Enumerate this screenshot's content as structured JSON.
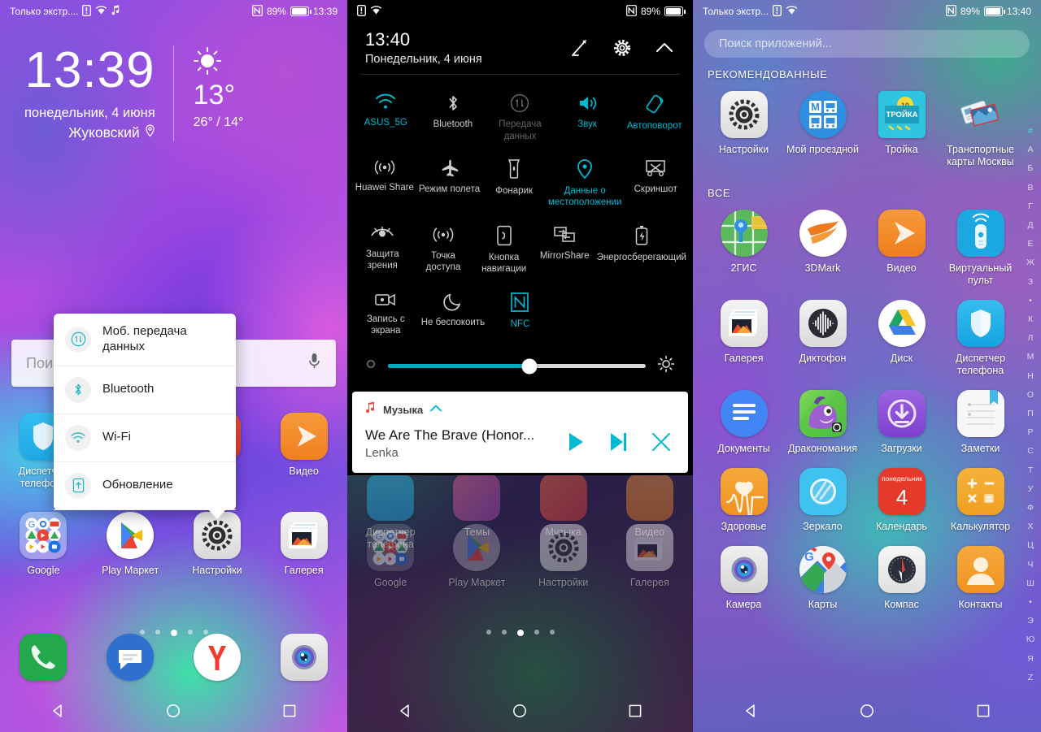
{
  "colors": {
    "accent": "#00b9d4",
    "accent_dark": "#00a9c4",
    "white": "#ffffff"
  },
  "panel1": {
    "statusbar": {
      "carrier": "Только экстр....",
      "battery_percent": "89%",
      "time": "13:39"
    },
    "clock_widget": {
      "time": "13:39",
      "date": "понедельник, 4 июня",
      "city": "Жуковский",
      "temp_now": "13°",
      "temp_range": "26° / 14°"
    },
    "search_widget": {
      "placeholder": "Пои"
    },
    "popup": {
      "items": [
        {
          "label": "Моб. передача данных",
          "icon": "mobile-data-icon"
        },
        {
          "label": "Bluetooth",
          "icon": "bluetooth-icon"
        },
        {
          "label": "Wi-Fi",
          "icon": "wifi-icon"
        },
        {
          "label": "Обновление",
          "icon": "update-icon"
        }
      ]
    },
    "apps_row1": [
      {
        "label": "Диспетчер телефона",
        "icon": "phone-manager-icon"
      },
      {
        "label": "",
        "icon": "themes-icon"
      },
      {
        "label": "",
        "icon": "music-icon"
      },
      {
        "label": "Видео",
        "icon": "video-icon"
      }
    ],
    "apps_row2": [
      {
        "label": "Google",
        "icon": "google-folder-icon"
      },
      {
        "label": "Play Маркет",
        "icon": "play-store-icon"
      },
      {
        "label": "Настройки",
        "icon": "settings-icon"
      },
      {
        "label": "Галерея",
        "icon": "gallery-icon"
      }
    ],
    "page_dots": {
      "count": 5,
      "active_index": 2
    },
    "dock": [
      {
        "label": "",
        "icon": "phone-icon"
      },
      {
        "label": "",
        "icon": "messages-icon"
      },
      {
        "label": "",
        "icon": "yandex-icon"
      },
      {
        "label": "",
        "icon": "camera-icon"
      }
    ],
    "navbar": [
      {
        "name": "back-button",
        "icon": "triangle-back-icon"
      },
      {
        "name": "home-button",
        "icon": "circle-home-icon"
      },
      {
        "name": "recents-button",
        "icon": "square-recents-icon"
      }
    ]
  },
  "panel2": {
    "statusbar": {
      "battery_percent": "89%"
    },
    "header": {
      "time": "13:40",
      "date": "Понедельник, 4 июня",
      "edit": "edit-icon",
      "settings": "gear-icon",
      "collapse": "chevron-up-icon"
    },
    "tiles": [
      {
        "label": "ASUS_5G",
        "icon": "wifi-icon",
        "state": "on"
      },
      {
        "label": "Bluetooth",
        "icon": "bluetooth-icon",
        "state": "default"
      },
      {
        "label": "Передача данных",
        "icon": "mobile-data-icon",
        "state": "disabled"
      },
      {
        "label": "Звук",
        "icon": "sound-icon",
        "state": "on"
      },
      {
        "label": "Автоповорот",
        "icon": "autorotate-icon",
        "state": "on"
      },
      {
        "label": "Huawei Share",
        "icon": "huawei-share-icon",
        "state": "default"
      },
      {
        "label": "Режим полета",
        "icon": "airplane-icon",
        "state": "default"
      },
      {
        "label": "Фонарик",
        "icon": "flashlight-icon",
        "state": "default"
      },
      {
        "label": "Данные о местоположении",
        "icon": "location-icon",
        "state": "on"
      },
      {
        "label": "Скриншот",
        "icon": "screenshot-icon",
        "state": "default"
      },
      {
        "label": "Защита зрения",
        "icon": "eye-comfort-icon",
        "state": "default"
      },
      {
        "label": "Точка доступа",
        "icon": "hotspot-icon",
        "state": "default"
      },
      {
        "label": "Кнопка навигации",
        "icon": "nav-button-icon",
        "state": "default"
      },
      {
        "label": "MirrorShare",
        "icon": "mirrorshare-icon",
        "state": "default"
      },
      {
        "label": "Энергосберегающий",
        "icon": "power-save-icon",
        "state": "default"
      },
      {
        "label": "Запись с экрана",
        "icon": "screen-record-icon",
        "state": "default"
      },
      {
        "label": "Не беспокоить",
        "icon": "do-not-disturb-icon",
        "state": "default"
      },
      {
        "label": "NFC",
        "icon": "nfc-icon",
        "state": "on"
      }
    ],
    "brightness": {
      "value_percent": 55,
      "low_icon": "brightness-low-icon",
      "high_icon": "brightness-high-icon"
    },
    "notification": {
      "app": "Музыка",
      "title": "We Are The Brave (Honor...",
      "artist": "Lenka",
      "controls": [
        {
          "name": "play-button",
          "icon": "play-icon"
        },
        {
          "name": "next-button",
          "icon": "next-track-icon"
        },
        {
          "name": "dismiss-button",
          "icon": "close-icon"
        }
      ]
    },
    "dim_home": {
      "row1": [
        {
          "label": "Диспетчер телефона",
          "icon": "phone-manager-icon"
        },
        {
          "label": "Темы",
          "icon": "themes-icon"
        },
        {
          "label": "Музыка",
          "icon": "music-icon"
        },
        {
          "label": "Видео",
          "icon": "video-icon"
        }
      ],
      "row2": [
        {
          "label": "Google",
          "icon": "google-folder-icon"
        },
        {
          "label": "Play Маркет",
          "icon": "play-store-icon"
        },
        {
          "label": "Настройки",
          "icon": "settings-icon"
        },
        {
          "label": "Галерея",
          "icon": "gallery-icon"
        }
      ],
      "page_dots": {
        "count": 5,
        "active_index": 2
      }
    }
  },
  "panel3": {
    "statusbar": {
      "carrier": "Только экстр...",
      "battery_percent": "89%",
      "time": "13:40"
    },
    "search": {
      "placeholder": "Поиск приложений..."
    },
    "sections": [
      {
        "title": "РЕКОМЕНДОВАННЫЕ",
        "apps": [
          {
            "label": "Настройки",
            "icon": "settings-icon"
          },
          {
            "label": "Мой проездной",
            "icon": "moy-proezdnoy-icon"
          },
          {
            "label": "Тройка",
            "icon": "troika-icon"
          },
          {
            "label": "Транспортные карты Москвы",
            "icon": "transport-cards-icon"
          }
        ]
      },
      {
        "title": "ВСЕ",
        "apps": [
          {
            "label": "2ГИС",
            "icon": "2gis-icon"
          },
          {
            "label": "3DMark",
            "icon": "3dmark-icon"
          },
          {
            "label": "Видео",
            "icon": "video-icon"
          },
          {
            "label": "Виртуальный пульт",
            "icon": "virtual-remote-icon"
          },
          {
            "label": "Галерея",
            "icon": "gallery-icon"
          },
          {
            "label": "Диктофон",
            "icon": "recorder-icon"
          },
          {
            "label": "Диск",
            "icon": "google-drive-icon"
          },
          {
            "label": "Диспетчер телефона",
            "icon": "phone-manager-icon"
          },
          {
            "label": "Документы",
            "icon": "google-docs-icon"
          },
          {
            "label": "Дракономания",
            "icon": "dragon-mania-icon"
          },
          {
            "label": "Загрузки",
            "icon": "downloads-icon"
          },
          {
            "label": "Заметки",
            "icon": "notes-icon"
          },
          {
            "label": "Здоровье",
            "icon": "health-icon"
          },
          {
            "label": "Зеркало",
            "icon": "mirror-icon"
          },
          {
            "label": "Календарь",
            "icon": "calendar-icon",
            "badge_top": "понедельник",
            "badge_day": "4"
          },
          {
            "label": "Калькулятор",
            "icon": "calculator-icon"
          },
          {
            "label": "Камера",
            "icon": "camera-icon"
          },
          {
            "label": "Карты",
            "icon": "google-maps-icon"
          },
          {
            "label": "Компас",
            "icon": "compass-icon"
          },
          {
            "label": "Контакты",
            "icon": "contacts-icon"
          }
        ]
      }
    ],
    "alphabet_index": [
      "#",
      "А",
      "Б",
      "В",
      "Г",
      "Д",
      "Е",
      "Ж",
      "З",
      "•",
      "К",
      "Л",
      "М",
      "Н",
      "О",
      "П",
      "Р",
      "С",
      "Т",
      "У",
      "Ф",
      "Х",
      "Ц",
      "Ч",
      "Ш",
      "•",
      "Э",
      "Ю",
      "Я",
      "Z"
    ]
  }
}
